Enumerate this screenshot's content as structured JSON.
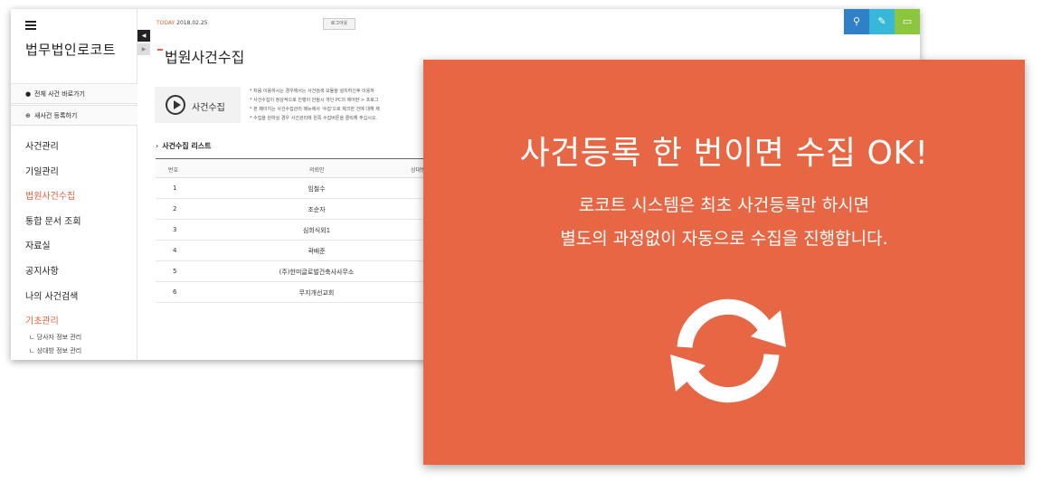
{
  "app": {
    "brand": "법무법인로코트",
    "today_label": "TODAY",
    "today_date": "2018.02.25",
    "logout_label": "로그아웃"
  },
  "sidebar": {
    "quick_buttons": [
      {
        "label": "전체 사건 바로가기",
        "icon": "person-icon"
      },
      {
        "label": "새사건 등록하기",
        "icon": "plus-circle-icon"
      }
    ],
    "items": [
      {
        "label": "사건관리"
      },
      {
        "label": "기일관리"
      },
      {
        "label": "법원사건수집",
        "active": true
      },
      {
        "label": "통합 문서 조회"
      },
      {
        "label": "자료실"
      },
      {
        "label": "공지사항"
      },
      {
        "label": "나의 사건검색"
      },
      {
        "label": "기초관리",
        "active": true
      }
    ],
    "sub_items": [
      {
        "label": "ㄴ 당사자 정보 관리"
      },
      {
        "label": "ㄴ 상대방 정보 관리"
      }
    ]
  },
  "top_icons": [
    "search-icon",
    "edit-icon",
    "monitor-icon"
  ],
  "main": {
    "page_title": "법원사건수집",
    "collect_button": "사건수집",
    "notes": [
      "* 처음 이용하시는 경우에서는 사건검색 모듈을 설치하신후 이용하",
      "* 사건수집이 정상적으로 진행이 안될시 개인 PC의 제어판 > 프로그",
      "* 본 페이지는 사건수집관리 메뉴에서 '수집'으로 체크한 건에 대해 재",
      "* 수집을 원하실 경우 사건관리에 왼쪽 수집버튼을 클릭해 주십시오."
    ],
    "list_title": "사건수집 리스트",
    "table": {
      "columns": [
        "번호",
        "의뢰인",
        "상대방"
      ],
      "rows": [
        {
          "no": "1",
          "client": "임철수"
        },
        {
          "no": "2",
          "client": "조순자"
        },
        {
          "no": "3",
          "client": "심희식외1"
        },
        {
          "no": "4",
          "client": "곽배준"
        },
        {
          "no": "5",
          "client": "(주)한미글로벌건축사사무소"
        },
        {
          "no": "6",
          "client": "무지개선교회"
        }
      ]
    }
  },
  "promo": {
    "title": "사건등록 한 번이면 수집 OK!",
    "line1": "로코트 시스템은 최초 사건등록만 하시면",
    "line2": "별도의 과정없이 자동으로 수집을 진행합니다.",
    "icon": "sync-icon",
    "background": "#e76745"
  }
}
